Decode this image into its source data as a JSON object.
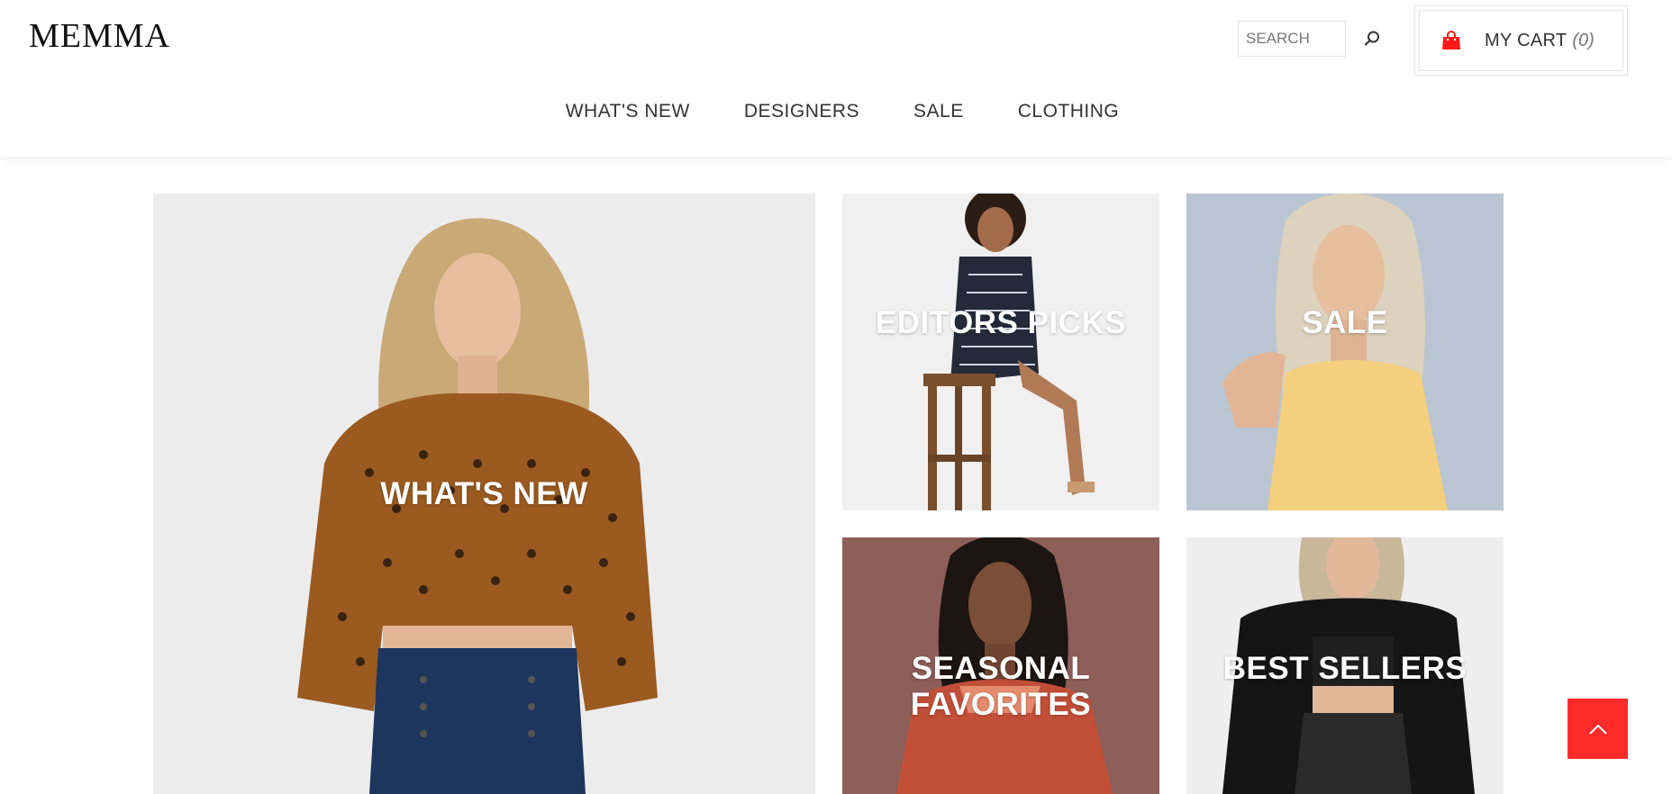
{
  "header": {
    "logo": "MEMMA",
    "search_placeholder": "SEARCH",
    "search_icon": "search-icon",
    "cart": {
      "icon": "shopping-bag-icon",
      "label": "MY CART",
      "count": "(0)",
      "icon_color": "#ff1a1a"
    }
  },
  "nav": {
    "items": [
      {
        "label": "WHAT'S NEW"
      },
      {
        "label": "DESIGNERS"
      },
      {
        "label": "SALE"
      },
      {
        "label": "CLOTHING"
      }
    ]
  },
  "tiles": {
    "whats_new": {
      "label": "WHAT'S NEW"
    },
    "editors_picks": {
      "label": "EDITORS PICKS"
    },
    "sale": {
      "label": "SALE"
    },
    "seasonal": {
      "label_line1": "SEASONAL",
      "label_line2": "FAVORITES"
    },
    "best_sellers": {
      "label": "BEST SELLERS"
    }
  },
  "scroll_top": {
    "icon": "chevron-up-icon",
    "color": "#ff2a2a"
  }
}
